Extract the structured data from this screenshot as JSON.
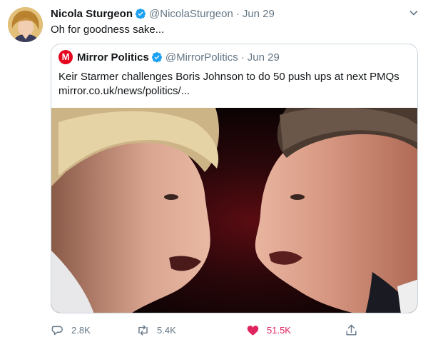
{
  "tweet": {
    "author_name": "Nicola Sturgeon",
    "handle": "@NicolaSturgeon",
    "separator": "·",
    "date": "Jun 29",
    "text": "Oh for goodness sake..."
  },
  "quote": {
    "author_name": "Mirror Politics",
    "logo_letter": "M",
    "handle": "@MirrorPolitics",
    "separator": "·",
    "date": "Jun 29",
    "headline": "Keir Starmer challenges Boris Johnson to do 50 push ups at next PMQs",
    "link": "mirror.co.uk/news/politics/..."
  },
  "actions": {
    "replies": "2.8K",
    "retweets": "5.4K",
    "likes": "51.5K"
  },
  "colors": {
    "verified_blue": "#1da1f2",
    "like_red": "#e0245e",
    "muted_gray": "#657786",
    "mirror_red": "#e4051f",
    "border": "#ccd6dd"
  },
  "icons": {
    "reply": "reply-icon",
    "retweet": "retweet-icon",
    "like": "heart-icon",
    "share": "share-icon",
    "verified": "verified-badge-icon",
    "more": "chevron-down-icon"
  }
}
